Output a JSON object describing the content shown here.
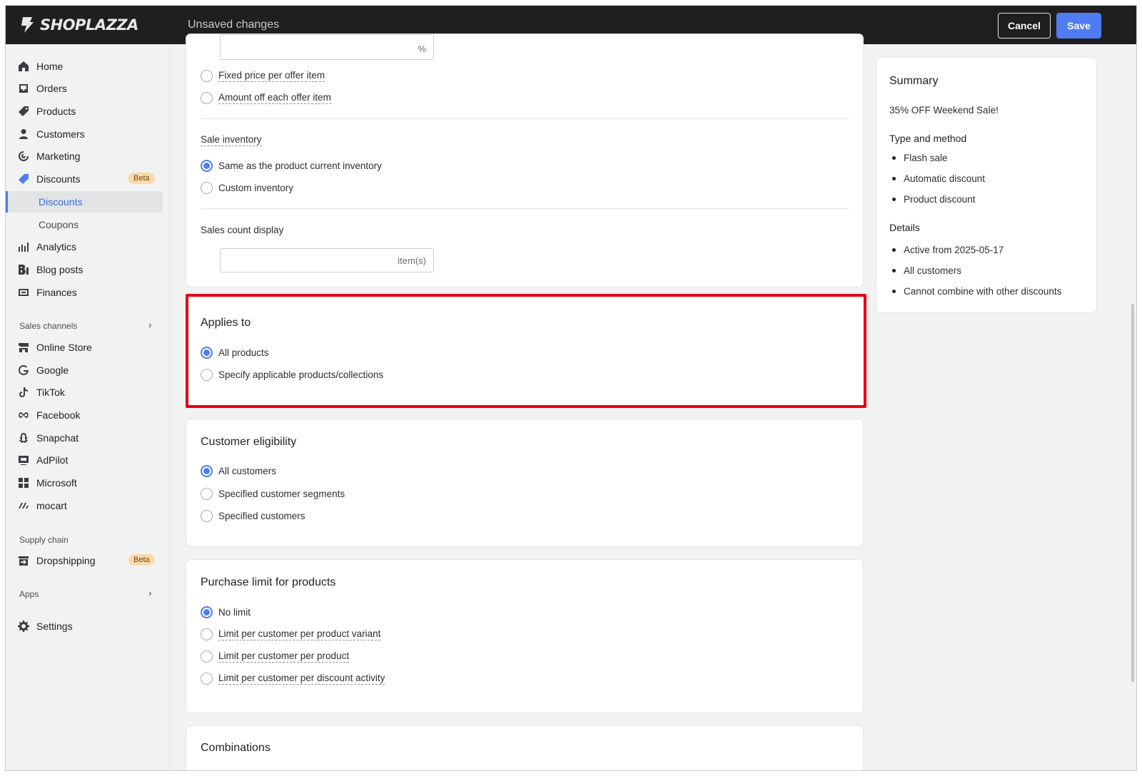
{
  "topbar": {
    "logo_text": "SHOPLAZZA",
    "status": "Unsaved changes",
    "cancel_label": "Cancel",
    "save_label": "Save"
  },
  "sidebar": {
    "items": [
      {
        "label": "Home",
        "icon": "home-icon"
      },
      {
        "label": "Orders",
        "icon": "inbox-icon"
      },
      {
        "label": "Products",
        "icon": "tag-icon"
      },
      {
        "label": "Customers",
        "icon": "person-icon"
      },
      {
        "label": "Marketing",
        "icon": "target-icon"
      },
      {
        "label": "Discounts",
        "icon": "discount-icon",
        "badge": "Beta"
      },
      {
        "label": "Analytics",
        "icon": "bar-chart-icon"
      },
      {
        "label": "Blog posts",
        "icon": "blog-icon"
      },
      {
        "label": "Finances",
        "icon": "wallet-icon"
      }
    ],
    "sub_items": [
      {
        "label": "Discounts",
        "active": true
      },
      {
        "label": "Coupons",
        "active": false
      }
    ],
    "sales_channels_label": "Sales channels",
    "channels": [
      {
        "label": "Online Store",
        "icon": "store-icon"
      },
      {
        "label": "Google",
        "icon": "google-icon"
      },
      {
        "label": "TikTok",
        "icon": "tiktok-icon"
      },
      {
        "label": "Facebook",
        "icon": "meta-icon"
      },
      {
        "label": "Snapchat",
        "icon": "ghost-icon"
      },
      {
        "label": "AdPilot",
        "icon": "ad-icon"
      },
      {
        "label": "Microsoft",
        "icon": "grid-icon"
      },
      {
        "label": "mocart",
        "icon": "mocart-icon"
      }
    ],
    "supply_chain_label": "Supply chain",
    "dropshipping": {
      "label": "Dropshipping",
      "icon": "dropship-icon",
      "badge": "Beta"
    },
    "apps_label": "Apps",
    "settings_label": "Settings"
  },
  "pricing_card": {
    "input_suffix": "%",
    "options": [
      "Fixed price per offer item",
      "Amount off each offer item"
    ],
    "sale_inventory_label": "Sale inventory",
    "inventory_options": [
      {
        "label": "Same as the product current inventory",
        "selected": true
      },
      {
        "label": "Custom inventory",
        "selected": false
      }
    ],
    "sales_count_label": "Sales count display",
    "sales_count_suffix": "item(s)"
  },
  "applies_to": {
    "title": "Applies to",
    "options": [
      {
        "label": "All products",
        "selected": true
      },
      {
        "label": "Specify applicable products/collections",
        "selected": false
      }
    ]
  },
  "customer_eligibility": {
    "title": "Customer eligibility",
    "options": [
      {
        "label": "All customers",
        "selected": true
      },
      {
        "label": "Specified customer segments",
        "selected": false
      },
      {
        "label": "Specified customers",
        "selected": false
      }
    ]
  },
  "purchase_limit": {
    "title": "Purchase limit for products",
    "options": [
      {
        "label": "No limit",
        "selected": true
      },
      {
        "label": "Limit per customer per product variant",
        "selected": false
      },
      {
        "label": "Limit per customer per product",
        "selected": false
      },
      {
        "label": "Limit per customer per discount activity",
        "selected": false
      }
    ]
  },
  "combinations": {
    "title": "Combinations"
  },
  "summary": {
    "title": "Summary",
    "name": "35% OFF Weekend Sale!",
    "type_heading": "Type and method",
    "type_items": [
      "Flash sale",
      "Automatic discount",
      "Product discount"
    ],
    "details_heading": "Details",
    "details_items": [
      "Active from 2025-05-17",
      "All customers",
      "Cannot combine with other discounts"
    ]
  },
  "colors": {
    "accent": "#4f7cf4",
    "highlight": "#e3001b",
    "topbar": "#1f1f1f",
    "badge": "#fcd9a8"
  }
}
